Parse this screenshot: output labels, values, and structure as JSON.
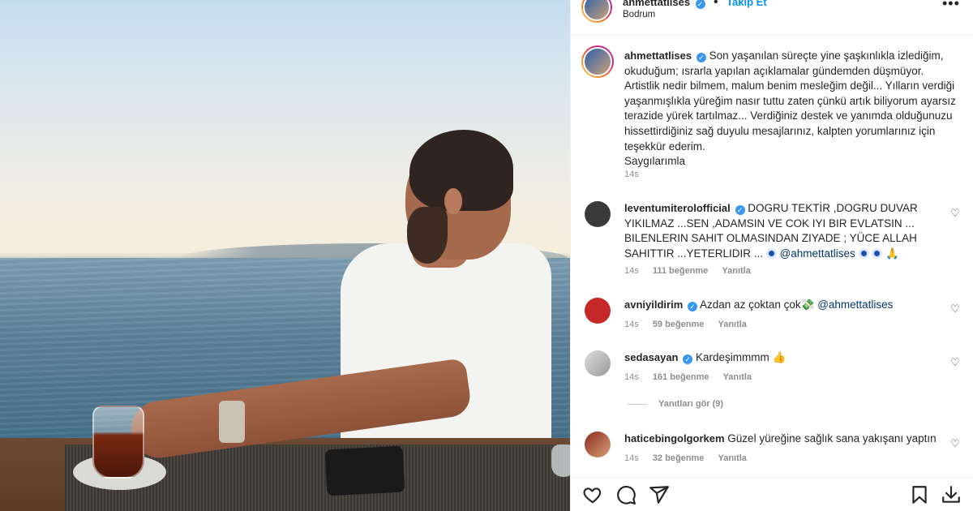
{
  "header": {
    "username": "ahmettatlises",
    "follow_label": "Takip Et",
    "location": "Bodrum",
    "more_icon": "more-horizontal-icon"
  },
  "caption": {
    "username": "ahmettatlises",
    "text": "Son yaşanılan süreçte yine şaşkınlıkla izlediğim, okuduğum; ısrarla yapılan açıklamalar gündemden düşmüyor. Artistlik nedir bilmem, malum benim mesleğim değil... Yılların verdiği yaşanmışlıkla yüreğim nasır tuttu zaten çünkü artık biliyorum ayarsız terazide yürek tartılmaz... Verdiğiniz destek ve yanımda olduğunuzu hissettirdiğiniz sağ duyulu mesajlarınız, kalpten yorumlarınız için teşekkür ederim.",
    "signoff": "Saygılarımla",
    "time": "14s"
  },
  "comments": [
    {
      "username": "leventumiterolofficial",
      "text": "DOGRU TEKTİR ,DOGRU DUVAR YIKILMAZ ...SEN ,ADAMSIN VE COK IYI BIR EVLATSIN ... BILENLERIN SAHIT OLMASINDAN ZIYADE ; YÜCE ALLAH SAHITTIR ...YETERLIDIR ...",
      "mention": "@ahmettatlises",
      "time": "14s",
      "likes": "111 beğenme",
      "reply": "Yanıtla"
    },
    {
      "username": "avniyildirim",
      "text": "Azdan az çoktan çok",
      "mention": "@ahmettatlises",
      "time": "14s",
      "likes": "59 beğenme",
      "reply": "Yanıtla"
    },
    {
      "username": "sedasayan",
      "text": "Kardeşimmmm",
      "time": "14s",
      "likes": "161 beğenme",
      "reply": "Yanıtla"
    },
    {
      "username": "haticebingolgorkem",
      "text": "Güzel yüreğine sağlık sana yakışanı yaptın",
      "time": "14s",
      "likes": "32 beğenme",
      "reply": "Yanıtla"
    }
  ],
  "view_replies": "Yanıtları gör (9)",
  "colors": {
    "verified": "#3897f0",
    "follow": "#0095f6",
    "muted": "#8e8e8e",
    "text": "#262626"
  },
  "icons": [
    "heart-icon",
    "comment-icon",
    "share-icon",
    "bookmark-icon",
    "download-icon"
  ]
}
